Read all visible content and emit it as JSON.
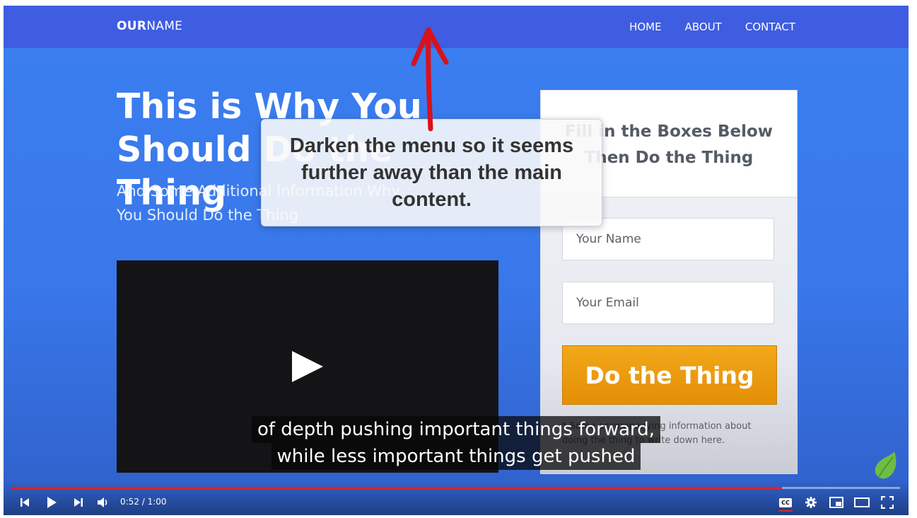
{
  "nav": {
    "brand_bold": "OUR",
    "brand_rest": "NAME",
    "links": [
      "HOME",
      "ABOUT",
      "CONTACT"
    ]
  },
  "hero": {
    "title": "This is Why You Should Do the Thing",
    "subtitle": "And Some Additional Information Why You Should Do the Thing"
  },
  "form": {
    "title": "Fill in the Boxes Below Then Do the Thing",
    "name_placeholder": "Your Name",
    "email_placeholder": "Your Email",
    "button_label": "Do the Thing",
    "fine_print": "* Some accompanying information about doing the thing to write down here."
  },
  "annotation": {
    "text": "Darken the menu so it seems further away than the main content."
  },
  "captions": {
    "line1": "of depth pushing important things forward,",
    "line2": "while less important things get pushed"
  },
  "player": {
    "current_time": "0:52",
    "duration": "1:00",
    "time_display": "0:52 / 1:00",
    "progress_fraction": 0.867,
    "cc_label": "CC",
    "accent_color": "#e62117",
    "icons": [
      "skip-previous-icon",
      "play-icon",
      "skip-next-icon",
      "volume-icon",
      "closed-captions-icon",
      "settings-gear-icon",
      "miniplayer-icon",
      "theater-mode-icon",
      "fullscreen-icon",
      "envato-leaf-icon"
    ]
  }
}
